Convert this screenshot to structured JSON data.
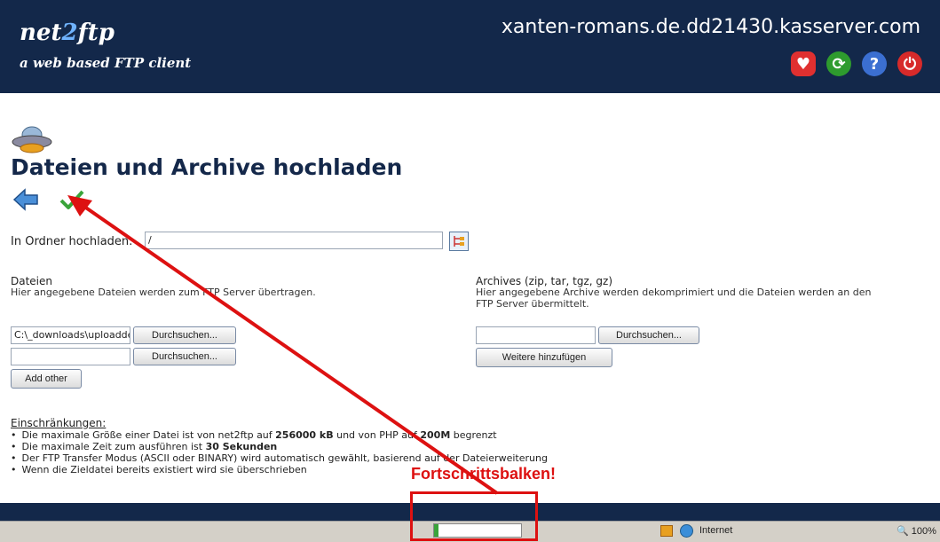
{
  "app": {
    "logo_text_a": "net",
    "logo_text_b": "2",
    "logo_text_c": "ftp",
    "logo_subtitle": "a web based FTP client",
    "server": "xanten-romans.de.dd21430.kasserver.com",
    "header_icons": [
      "heart-icon",
      "refresh-icon",
      "help-icon",
      "power-icon"
    ]
  },
  "page": {
    "title": "Dateien und Archive hochladen",
    "folder_label": "In Ordner hochladen:",
    "folder_value": "/"
  },
  "files": {
    "title": "Dateien",
    "desc": "Hier angegebene Dateien werden zum FTP Server übertragen.",
    "file1_value": "C:\\_downloads\\uploadde",
    "file2_value": "",
    "browse_label": "Durchsuchen...",
    "add_other_label": "Add other"
  },
  "archives": {
    "title": "Archives (zip, tar, tgz, gz)",
    "desc_line1": "Hier angegebene Archive werden dekomprimiert und die Dateien werden an den",
    "desc_line2": "FTP Server übermittelt.",
    "file1_value": "",
    "browse_label": "Durchsuchen...",
    "add_more_label": "Weitere hinzufügen"
  },
  "restrictions": {
    "title": "Einschränkungen:",
    "items": [
      [
        "Die maximale Größe einer Datei ist von net2ftp auf ",
        "256000 kB",
        " und von PHP auf ",
        "200M",
        " begrenzt"
      ],
      [
        "Die maximale Zeit zum ausführen ist ",
        "30 Sekunden",
        "",
        "",
        ""
      ],
      [
        "Der FTP Transfer Modus (ASCII oder BINARY) wird automatisch gewählt, basierend auf der Dateierweiterung",
        "",
        "",
        "",
        ""
      ],
      [
        "Wenn die Zieldatei bereits existiert wird sie überschrieben",
        "",
        "",
        "",
        ""
      ]
    ]
  },
  "annotation": {
    "label": "Fortschrittsbalken!",
    "color": "#dd1111"
  },
  "status_bar": {
    "zone": "Internet",
    "zoom": "100%",
    "progress_fraction": 0.05
  }
}
